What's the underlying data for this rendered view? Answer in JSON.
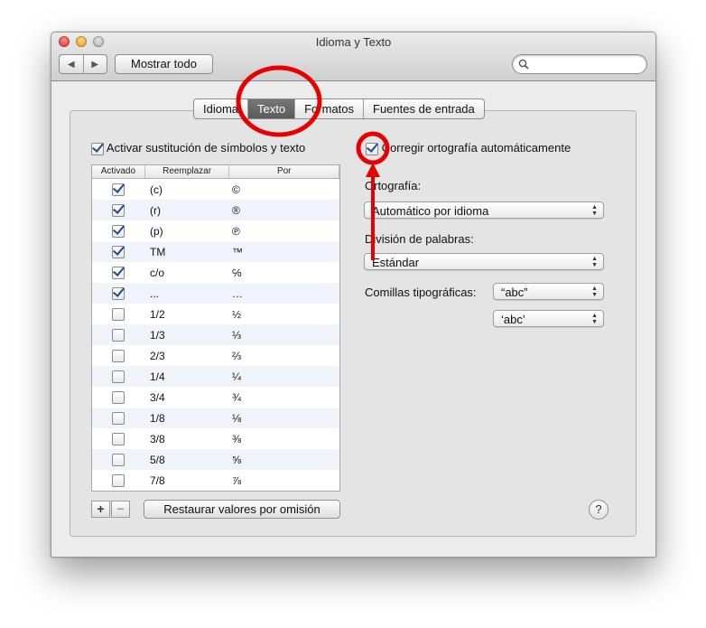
{
  "window": {
    "title": "Idioma y Texto",
    "show_all_label": "Mostrar todo",
    "back_icon": "◀",
    "forward_icon": "▶",
    "search": {
      "value": "",
      "placeholder": ""
    }
  },
  "tabs": [
    "Idioma",
    "Texto",
    "Formatos",
    "Fuentes de entrada"
  ],
  "selected_tab": "Texto",
  "substitution": {
    "label": "Activar sustitución de símbolos y texto",
    "checked": true,
    "columns": [
      "Activado",
      "Reemplazar",
      "Por"
    ],
    "rows": [
      {
        "on": true,
        "replace": "(c)",
        "with": "©"
      },
      {
        "on": true,
        "replace": "(r)",
        "with": "®"
      },
      {
        "on": true,
        "replace": "(p)",
        "with": "℗"
      },
      {
        "on": true,
        "replace": "TM",
        "with": "™"
      },
      {
        "on": true,
        "replace": "c/o",
        "with": "℅"
      },
      {
        "on": true,
        "replace": "...",
        "with": "…"
      },
      {
        "on": false,
        "replace": "1/2",
        "with": "½"
      },
      {
        "on": false,
        "replace": "1/3",
        "with": "⅓"
      },
      {
        "on": false,
        "replace": "2/3",
        "with": "⅔"
      },
      {
        "on": false,
        "replace": "1/4",
        "with": "¼"
      },
      {
        "on": false,
        "replace": "3/4",
        "with": "¾"
      },
      {
        "on": false,
        "replace": "1/8",
        "with": "⅛"
      },
      {
        "on": false,
        "replace": "3/8",
        "with": "⅜"
      },
      {
        "on": false,
        "replace": "5/8",
        "with": "⅝"
      },
      {
        "on": false,
        "replace": "7/8",
        "with": "⅞"
      }
    ],
    "add_label": "+",
    "remove_label": "−",
    "restore_label": "Restaurar valores por omisión"
  },
  "spelling": {
    "autocorrect_label": "Corregir ortografía automáticamente",
    "autocorrect_checked": true,
    "spelling_label": "Ortografía:",
    "spelling_value": "Automático por idioma",
    "hyphenation_label": "División de palabras:",
    "hyphenation_value": "Estándar",
    "quotes_label": "Comillas tipográficas:",
    "double_quotes_value": "“abc”",
    "single_quotes_value": "‘abc’"
  },
  "help_label": "?",
  "annotation_color": "#e60000"
}
